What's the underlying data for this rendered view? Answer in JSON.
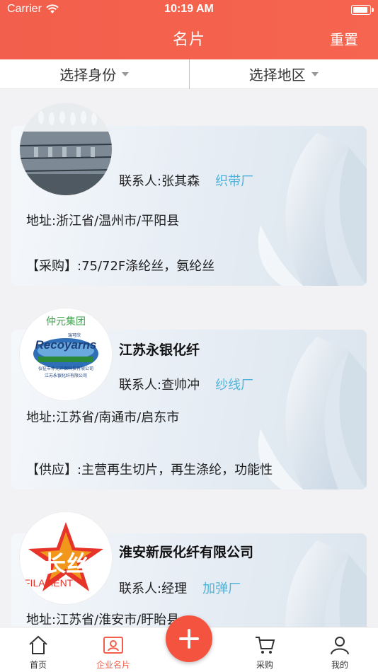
{
  "status": {
    "carrier": "Carrier",
    "time": "10:19 AM"
  },
  "nav": {
    "title": "名片",
    "right": "重置"
  },
  "filters": [
    {
      "label": "选择身份"
    },
    {
      "label": "选择地区"
    }
  ],
  "cards": [
    {
      "company": "",
      "contact": "联系人:张其森",
      "tag": "织带厂",
      "address": "地址:浙江省/温州市/平阳县",
      "info": "【采购】:75/72F涤纶丝，氨纶丝"
    },
    {
      "company": "江苏永银化纤",
      "contact": "联系人:查帅冲",
      "tag": "纱线厂",
      "address": "地址:江苏省/南通市/启东市",
      "info": "【供应】:主营再生切片，再生涤纶，功能性",
      "logo": {
        "top_text": "仲元集团",
        "brand_small": "瑞可欣",
        "brand": "Recoyarns",
        "line1": "仪征市仲元环保科技有限公司",
        "line2": "江苏永银化纤有限公司"
      }
    },
    {
      "company": "淮安新辰化纤有限公司",
      "contact": "联系人:经理",
      "tag": "加弹厂",
      "address": "地址:江苏省/淮安市/盱眙县",
      "logo": {
        "cn": "长丝",
        "en": "FILAMENT"
      }
    }
  ],
  "tabs": [
    {
      "label": "首页",
      "icon": "home-icon"
    },
    {
      "label": "企业名片",
      "icon": "card-icon",
      "active": true
    },
    {
      "label": "",
      "icon": "add-icon"
    },
    {
      "label": "采购",
      "icon": "cart-icon"
    },
    {
      "label": "我的",
      "icon": "user-icon"
    }
  ],
  "colors": {
    "accent": "#f25f4c",
    "tag": "#4fb3d9",
    "fab": "#f4543f"
  }
}
